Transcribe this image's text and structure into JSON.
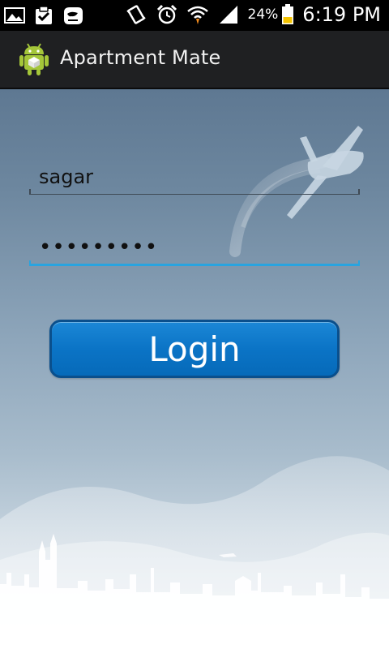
{
  "status_bar": {
    "left_icons": [
      "picture-icon",
      "clipboard-check-icon",
      "voicemail-icon"
    ],
    "right_icons": [
      "vibrate-icon",
      "alarm-icon",
      "wifi-icon",
      "signal-icon",
      "battery-icon"
    ],
    "battery_percent": "24%",
    "time": "6:19 PM"
  },
  "action_bar": {
    "app_icon": "android-icon",
    "title": "Apartment Mate"
  },
  "form": {
    "username_value": "sagar",
    "password_value": "•••••••••",
    "login_label": "Login"
  },
  "colors": {
    "accent": "#28a4e0",
    "button": "#0b74c6",
    "button_border": "#0a4f8c",
    "action_bar": "#1f2022"
  }
}
